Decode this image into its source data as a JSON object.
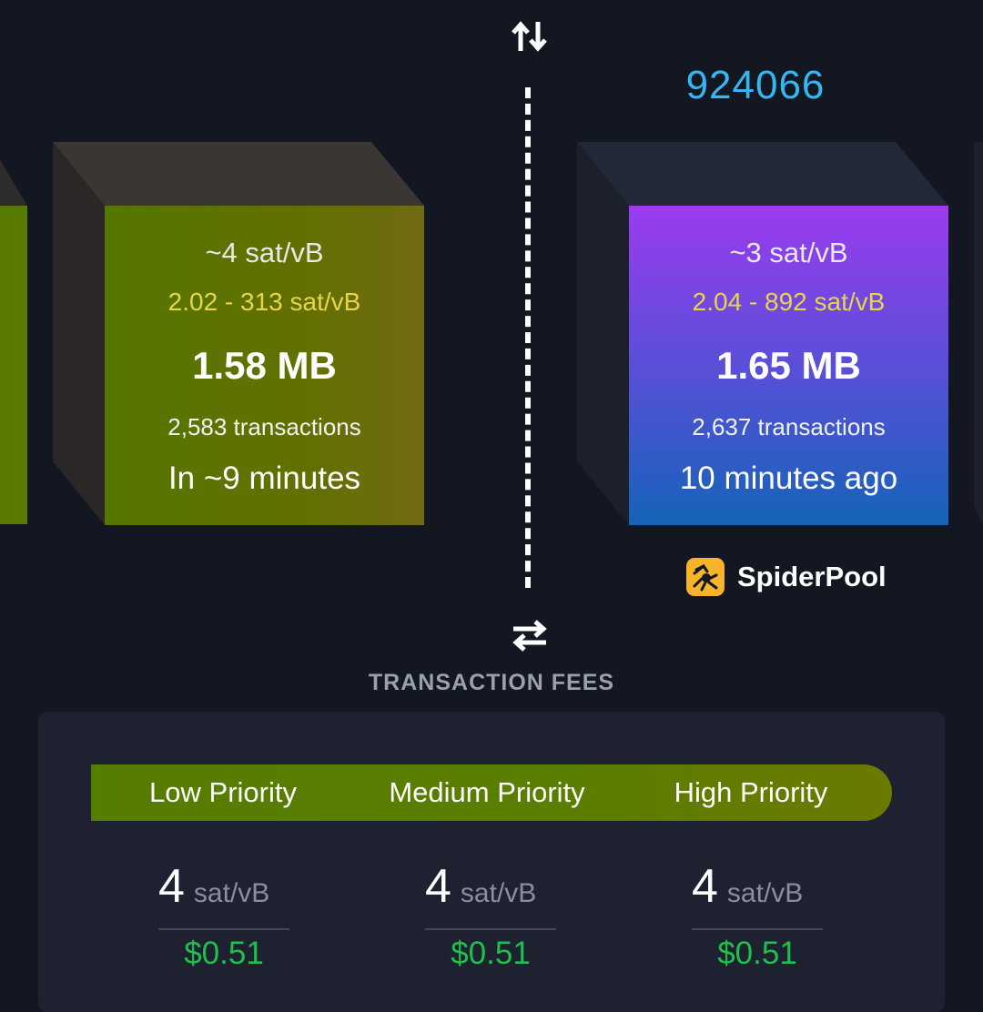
{
  "block_height": "924066",
  "pending_block": {
    "median_fee": "~4 sat/vB",
    "fee_range": "2.02 - 313 sat/vB",
    "size": "1.58 MB",
    "tx_count": "2,583 transactions",
    "time": "In ~9 minutes"
  },
  "mined_block": {
    "median_fee": "~3 sat/vB",
    "fee_range": "2.04 - 892 sat/vB",
    "size": "1.65 MB",
    "tx_count": "2,637 transactions",
    "time": "10 minutes ago",
    "pool_name": "SpiderPool"
  },
  "fees": {
    "title": "TRANSACTION FEES",
    "priorities": [
      "Low Priority",
      "Medium Priority",
      "High Priority"
    ],
    "values": [
      {
        "rate": "4",
        "unit": "sat/vB",
        "usd": "$0.51"
      },
      {
        "rate": "4",
        "unit": "sat/vB",
        "usd": "$0.51"
      },
      {
        "rate": "4",
        "unit": "sat/vB",
        "usd": "$0.51"
      }
    ]
  },
  "colors": {
    "accent_blue": "#36b6f0",
    "fee_range_yellow": "#e8d44a",
    "usd_green": "#1fbf4b",
    "pending_block": "#556b00",
    "mined_block_top": "#9b3bef",
    "mined_block_bottom": "#1565b7"
  },
  "icons": {
    "top_toggle": "swap-vertical-icon",
    "bottom_toggle": "swap-horizontal-icon",
    "pool_logo": "spiderpool-logo"
  }
}
